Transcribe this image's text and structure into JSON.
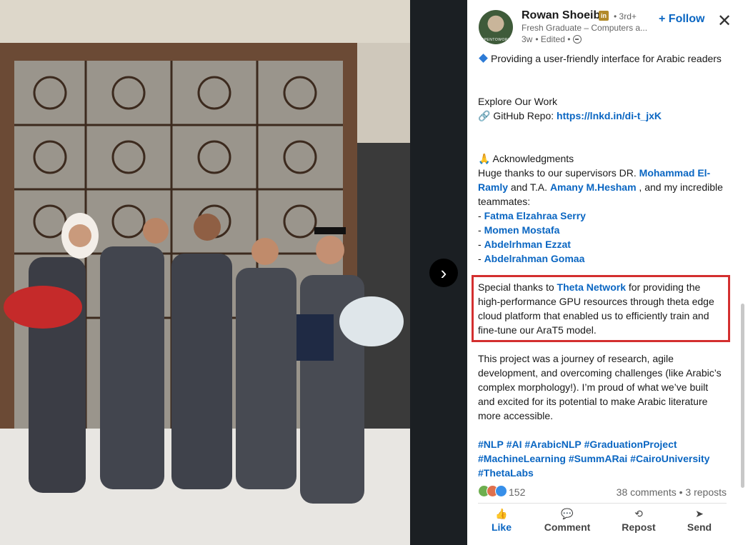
{
  "header": {
    "author_name": "Rowan Shoeib",
    "badge": "in",
    "degree": "• 3rd+",
    "headline": "Fresh Graduate – Computers a...",
    "time": "3w",
    "edited": "• Edited •",
    "follow_label": "+ Follow",
    "close_icon": "close-icon",
    "avatar_ring_text": "OPENTOWORK"
  },
  "post": {
    "line1_text": "Providing a user-friendly interface for Arabic readers",
    "explore_heading": "Explore Our Work",
    "github_prefix": "🔗 GitHub Repo: ",
    "github_url": "https://lnkd.in/di-t_jxK",
    "ack_heading": "🙏 Acknowledgments",
    "ack_intro": "Huge thanks to our supervisors DR. ",
    "supervisor1": "Mohammad El-Ramly",
    "ack_mid": " and T.A. ",
    "supervisor2": "Amany M.Hesham",
    "ack_end": " , and my incredible teammates:",
    "teammates": [
      "Fatma Elzahraa Serry",
      "Momen Mostafa",
      "Abdelrhman Ezzat",
      "Abdelrahman Gomaa"
    ],
    "special_prefix": "Special thanks to ",
    "special_org": "Theta Network",
    "special_rest": " for providing the high-performance GPU resources through theta edge cloud platform that enabled us to efficiently train and fine-tune our AraT5 model.",
    "journey": "This project was a journey of research, agile development, and overcoming challenges (like Arabic’s complex morphology!). I’m proud of what we’ve built and excited for its potential to make Arabic literature more accessible.",
    "hashtags": [
      "#NLP",
      "#AI",
      "#ArabicNLP",
      "#GraduationProject",
      "#MachineLearning",
      "#SummARai",
      "#CairoUniversity",
      "#ThetaLabs"
    ]
  },
  "social": {
    "reaction_count": "152",
    "comments": "38 comments",
    "reposts": "3 reposts",
    "separator": "•"
  },
  "actions": [
    {
      "label": "Like",
      "icon": "thumbs-up-icon",
      "glyph": "👍"
    },
    {
      "label": "Comment",
      "icon": "comment-icon",
      "glyph": "💬"
    },
    {
      "label": "Repost",
      "icon": "repost-icon",
      "glyph": "⟲"
    },
    {
      "label": "Send",
      "icon": "send-icon",
      "glyph": "➤"
    }
  ],
  "viewer": {
    "next_glyph": "›"
  },
  "colors": {
    "link": "#0a66c2",
    "highlight_border": "#d32f2f",
    "panel_bg": "#ffffff",
    "dark_bg": "#1b1f23"
  }
}
